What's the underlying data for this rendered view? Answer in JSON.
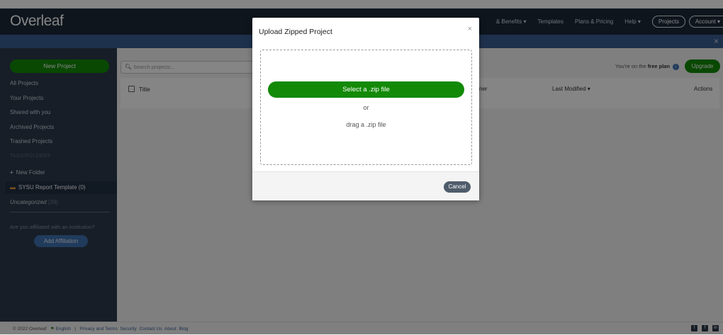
{
  "app": {
    "logo": "Overleaf"
  },
  "nav": {
    "features": "& Benefits ▾",
    "templates": "Templates",
    "plans": "Plans & Pricing",
    "help": "Help ▾",
    "projects": "Projects",
    "account": "Account ▾"
  },
  "notice": {
    "close": "×"
  },
  "sidebar": {
    "new_project": "New Project",
    "items": [
      {
        "label": "All Projects"
      },
      {
        "label": "Your Projects"
      },
      {
        "label": "Shared with you"
      },
      {
        "label": "Archived Projects"
      },
      {
        "label": "Trashed Projects"
      }
    ],
    "tags_header": "TAGS/FOLDERS",
    "new_folder": "New Folder",
    "folder": "SYSU Report Template (0)",
    "uncategorized": "Uncategorized",
    "uncategorized_count": "(39)",
    "affiliation_prompt": "Are you affiliated with an institution?",
    "add_affiliation": "Add Affiliation"
  },
  "main": {
    "search_placeholder": "Search projects...",
    "free_plan_prefix": "You're on the",
    "free_plan_bold": "free plan",
    "upgrade": "Upgrade",
    "columns": {
      "title": "Title",
      "owner": "ner",
      "last_modified": "Last Modified ▾",
      "actions": "Actions"
    }
  },
  "footer": {
    "copyright": "© 2022 Overleaf",
    "language": "English",
    "links": [
      "Privacy and Terms",
      "Security",
      "Contact Us",
      "About",
      "Blog"
    ]
  },
  "modal": {
    "title": "Upload Zipped Project",
    "close": "×",
    "select_button": "Select a .zip file",
    "or": "or",
    "drag_text": "drag a .zip file",
    "cancel": "Cancel"
  },
  "colors": {
    "navbar": "#1c2a38",
    "sidebar": "#2c3a4c",
    "primary_green": "#138a07",
    "notice_blue": "#3a5f92"
  }
}
